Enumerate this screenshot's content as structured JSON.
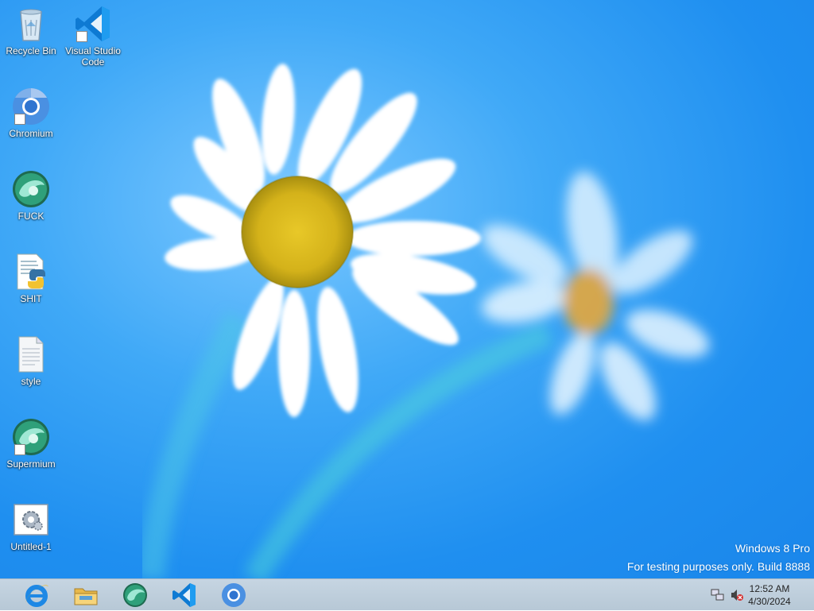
{
  "desktop_icons": [
    {
      "id": "recycle-bin",
      "label": "Recycle Bin",
      "icon": "recycle-bin-icon",
      "shortcut": false
    },
    {
      "id": "vscode",
      "label": "Visual Studio Code",
      "icon": "vscode-icon",
      "shortcut": true
    },
    {
      "id": "chromium",
      "label": "Chromium",
      "icon": "chromium-icon",
      "shortcut": true
    },
    {
      "id": "fuck",
      "label": "FUCK",
      "icon": "supermium-icon",
      "shortcut": false
    },
    {
      "id": "shit",
      "label": "SHIT",
      "icon": "python-file-icon",
      "shortcut": false
    },
    {
      "id": "style",
      "label": "style",
      "icon": "text-file-icon",
      "shortcut": false
    },
    {
      "id": "supermium",
      "label": "Supermium",
      "icon": "supermium-icon",
      "shortcut": true
    },
    {
      "id": "untitled-1",
      "label": "Untitled-1",
      "icon": "settings-file-icon",
      "shortcut": false
    }
  ],
  "watermark": {
    "line1": "Windows 8 Pro",
    "line2": "For testing purposes only. Build 8888"
  },
  "taskbar": {
    "pinned": [
      {
        "name": "internet-explorer",
        "icon": "internet-explorer-icon"
      },
      {
        "name": "file-explorer",
        "icon": "folder-icon"
      },
      {
        "name": "supermium",
        "icon": "supermium-icon"
      },
      {
        "name": "vscode",
        "icon": "vscode-icon"
      },
      {
        "name": "chromium",
        "icon": "chromium-icon"
      }
    ],
    "tray": {
      "network_icon": "network-icon",
      "volume_icon": "volume-muted-icon",
      "time": "12:52 AM",
      "date": "4/30/2024"
    }
  },
  "colors": {
    "wallpaper_blue": "#1f8ff0",
    "taskbar": "#c6d5e2",
    "vscode_blue": "#0e7ad3"
  }
}
